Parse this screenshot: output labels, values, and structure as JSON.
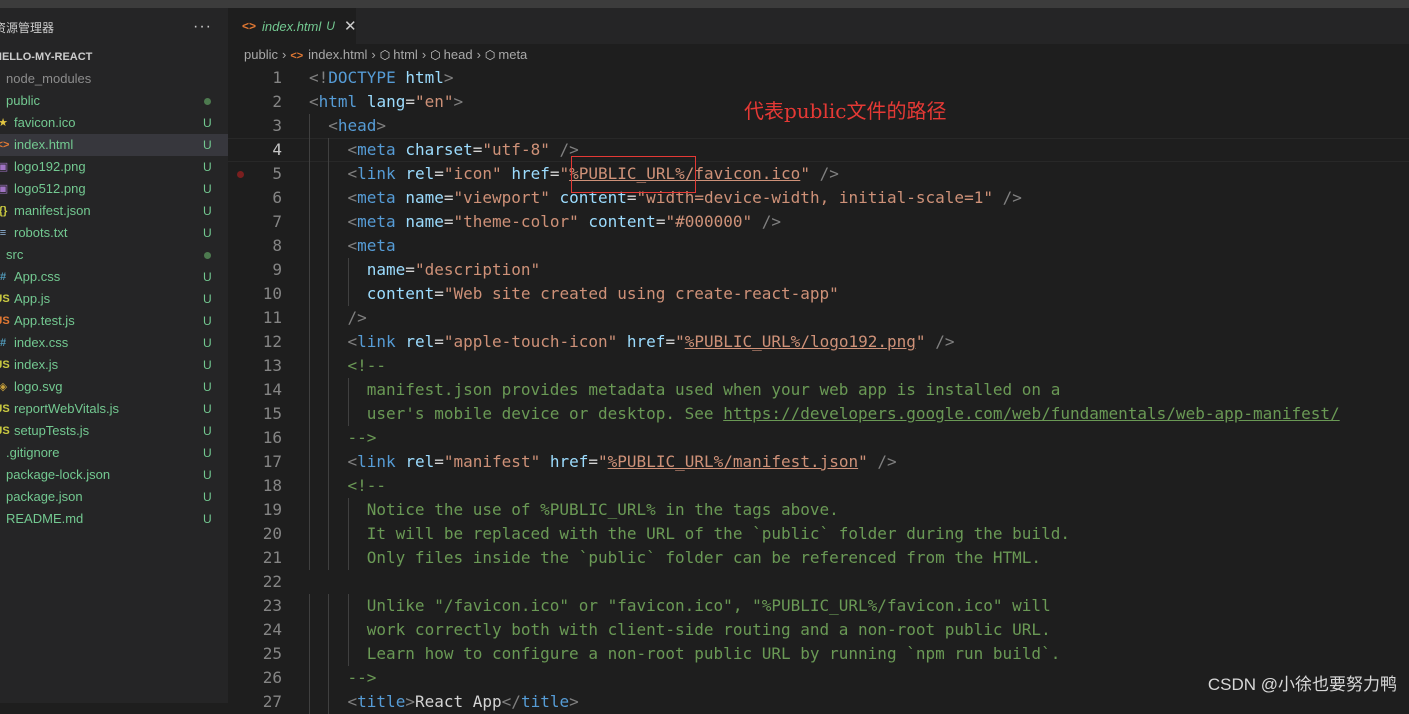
{
  "sidebar": {
    "title": "资源管理器",
    "more_label": "···",
    "section": "HELLO-MY-REACT",
    "items": [
      {
        "label": "node_modules",
        "kind": "folder",
        "icon": "",
        "status": "",
        "dot": false,
        "color": "#8c8c8c"
      },
      {
        "label": "public",
        "kind": "folder",
        "icon": "",
        "status": "",
        "dot": true,
        "color": "#73c991"
      },
      {
        "label": "favicon.ico",
        "kind": "file",
        "icon": "★",
        "iconColor": "#e2c541",
        "status": "U",
        "dot": false,
        "color": "#73c991"
      },
      {
        "label": "index.html",
        "kind": "file",
        "icon": "<>",
        "iconColor": "#e37933",
        "status": "U",
        "dot": false,
        "color": "#73c991",
        "selected": true
      },
      {
        "label": "logo192.png",
        "kind": "file",
        "icon": "▣",
        "iconColor": "#a074c4",
        "status": "U",
        "dot": false,
        "color": "#73c991"
      },
      {
        "label": "logo512.png",
        "kind": "file",
        "icon": "▣",
        "iconColor": "#a074c4",
        "status": "U",
        "dot": false,
        "color": "#73c991"
      },
      {
        "label": "manifest.json",
        "kind": "file",
        "icon": "{}",
        "iconColor": "#cbcb41",
        "status": "U",
        "dot": false,
        "color": "#73c991"
      },
      {
        "label": "robots.txt",
        "kind": "file",
        "icon": "≡",
        "iconColor": "#8fb4d8",
        "status": "U",
        "dot": false,
        "color": "#73c991"
      },
      {
        "label": "src",
        "kind": "folder",
        "icon": "",
        "status": "",
        "dot": true,
        "color": "#73c991"
      },
      {
        "label": "App.css",
        "kind": "file",
        "icon": "#",
        "iconColor": "#519aba",
        "status": "U",
        "dot": false,
        "color": "#73c991"
      },
      {
        "label": "App.js",
        "kind": "file",
        "icon": "JS",
        "iconColor": "#cbcb41",
        "status": "U",
        "dot": false,
        "color": "#73c991"
      },
      {
        "label": "App.test.js",
        "kind": "file",
        "icon": "JS",
        "iconColor": "#e37933",
        "status": "U",
        "dot": false,
        "color": "#73c991"
      },
      {
        "label": "index.css",
        "kind": "file",
        "icon": "#",
        "iconColor": "#519aba",
        "status": "U",
        "dot": false,
        "color": "#73c991"
      },
      {
        "label": "index.js",
        "kind": "file",
        "icon": "JS",
        "iconColor": "#cbcb41",
        "status": "U",
        "dot": false,
        "color": "#73c991"
      },
      {
        "label": "logo.svg",
        "kind": "file",
        "icon": "◈",
        "iconColor": "#c7a03a",
        "status": "U",
        "dot": false,
        "color": "#73c991"
      },
      {
        "label": "reportWebVitals.js",
        "kind": "file",
        "icon": "JS",
        "iconColor": "#cbcb41",
        "status": "U",
        "dot": false,
        "color": "#73c991"
      },
      {
        "label": "setupTests.js",
        "kind": "file",
        "icon": "JS",
        "iconColor": "#cbcb41",
        "status": "U",
        "dot": false,
        "color": "#73c991"
      },
      {
        "label": ".gitignore",
        "kind": "nofile",
        "icon": "",
        "status": "U",
        "dot": false,
        "color": "#73c991"
      },
      {
        "label": "package-lock.json",
        "kind": "nofile",
        "icon": "",
        "status": "U",
        "dot": false,
        "color": "#73c991"
      },
      {
        "label": "package.json",
        "kind": "nofile",
        "icon": "",
        "status": "U",
        "dot": false,
        "color": "#73c991"
      },
      {
        "label": "README.md",
        "kind": "nofile",
        "icon": "",
        "status": "U",
        "dot": false,
        "color": "#73c991"
      }
    ]
  },
  "tab": {
    "icon": "<>",
    "name": "index.html",
    "flag": "U",
    "close": "✕"
  },
  "breadcrumb": [
    {
      "label": "public",
      "icon": ""
    },
    {
      "label": "index.html",
      "icon": "<>"
    },
    {
      "label": "html",
      "icon": "⬡"
    },
    {
      "label": "head",
      "icon": "⬡"
    },
    {
      "label": "meta",
      "icon": "⬡"
    }
  ],
  "code": {
    "current_line": 4,
    "breakpoint_line": 5,
    "lines": [
      {
        "n": "1",
        "indent": 0,
        "tokens": [
          [
            "punc",
            "<!"
          ],
          [
            "tag",
            "DOCTYPE"
          ],
          [
            "txt",
            " "
          ],
          [
            "attr",
            "html"
          ],
          [
            "punc",
            ">"
          ]
        ]
      },
      {
        "n": "2",
        "indent": 0,
        "tokens": [
          [
            "punc",
            "<"
          ],
          [
            "tag",
            "html"
          ],
          [
            "txt",
            " "
          ],
          [
            "attr",
            "lang"
          ],
          [
            "txt",
            "="
          ],
          [
            "str",
            "\"en\""
          ],
          [
            "punc",
            ">"
          ]
        ]
      },
      {
        "n": "3",
        "indent": 1,
        "tokens": [
          [
            "punc",
            "<"
          ],
          [
            "tag",
            "head"
          ],
          [
            "punc",
            ">"
          ]
        ]
      },
      {
        "n": "4",
        "indent": 2,
        "tokens": [
          [
            "punc",
            "<"
          ],
          [
            "tag",
            "meta"
          ],
          [
            "txt",
            " "
          ],
          [
            "attr",
            "charset"
          ],
          [
            "txt",
            "="
          ],
          [
            "str",
            "\"utf-8\""
          ],
          [
            "txt",
            " "
          ],
          [
            "punc",
            "/>"
          ]
        ]
      },
      {
        "n": "5",
        "indent": 2,
        "tokens": [
          [
            "punc",
            "<"
          ],
          [
            "tag",
            "link"
          ],
          [
            "txt",
            " "
          ],
          [
            "attr",
            "rel"
          ],
          [
            "txt",
            "="
          ],
          [
            "str",
            "\"icon\""
          ],
          [
            "txt",
            " "
          ],
          [
            "attr",
            "href"
          ],
          [
            "txt",
            "="
          ],
          [
            "str",
            "\""
          ],
          [
            "sul",
            "%PUBLIC_URL%/favicon.ico"
          ],
          [
            "str",
            "\""
          ],
          [
            "txt",
            " "
          ],
          [
            "punc",
            "/>"
          ]
        ]
      },
      {
        "n": "6",
        "indent": 2,
        "tokens": [
          [
            "punc",
            "<"
          ],
          [
            "tag",
            "meta"
          ],
          [
            "txt",
            " "
          ],
          [
            "attr",
            "name"
          ],
          [
            "txt",
            "="
          ],
          [
            "str",
            "\"viewport\""
          ],
          [
            "txt",
            " "
          ],
          [
            "attr",
            "content"
          ],
          [
            "txt",
            "="
          ],
          [
            "str",
            "\"width=device-width, initial-scale=1\""
          ],
          [
            "txt",
            " "
          ],
          [
            "punc",
            "/>"
          ]
        ]
      },
      {
        "n": "7",
        "indent": 2,
        "tokens": [
          [
            "punc",
            "<"
          ],
          [
            "tag",
            "meta"
          ],
          [
            "txt",
            " "
          ],
          [
            "attr",
            "name"
          ],
          [
            "txt",
            "="
          ],
          [
            "str",
            "\"theme-color\""
          ],
          [
            "txt",
            " "
          ],
          [
            "attr",
            "content"
          ],
          [
            "txt",
            "="
          ],
          [
            "str",
            "\"#000000\""
          ],
          [
            "txt",
            " "
          ],
          [
            "punc",
            "/>"
          ]
        ]
      },
      {
        "n": "8",
        "indent": 2,
        "tokens": [
          [
            "punc",
            "<"
          ],
          [
            "tag",
            "meta"
          ]
        ]
      },
      {
        "n": "9",
        "indent": 3,
        "tokens": [
          [
            "attr",
            "name"
          ],
          [
            "txt",
            "="
          ],
          [
            "str",
            "\"description\""
          ]
        ]
      },
      {
        "n": "10",
        "indent": 3,
        "tokens": [
          [
            "attr",
            "content"
          ],
          [
            "txt",
            "="
          ],
          [
            "str",
            "\"Web site created using create-react-app\""
          ]
        ]
      },
      {
        "n": "11",
        "indent": 2,
        "tokens": [
          [
            "punc",
            "/>"
          ]
        ]
      },
      {
        "n": "12",
        "indent": 2,
        "tokens": [
          [
            "punc",
            "<"
          ],
          [
            "tag",
            "link"
          ],
          [
            "txt",
            " "
          ],
          [
            "attr",
            "rel"
          ],
          [
            "txt",
            "="
          ],
          [
            "str",
            "\"apple-touch-icon\""
          ],
          [
            "txt",
            " "
          ],
          [
            "attr",
            "href"
          ],
          [
            "txt",
            "="
          ],
          [
            "str",
            "\""
          ],
          [
            "sul",
            "%PUBLIC_URL%/logo192.png"
          ],
          [
            "str",
            "\""
          ],
          [
            "txt",
            " "
          ],
          [
            "punc",
            "/>"
          ]
        ]
      },
      {
        "n": "13",
        "indent": 2,
        "tokens": [
          [
            "com",
            "<!--"
          ]
        ]
      },
      {
        "n": "14",
        "indent": 3,
        "tokens": [
          [
            "com",
            "manifest.json provides metadata used when your web app is installed on a"
          ]
        ]
      },
      {
        "n": "15",
        "indent": 3,
        "tokens": [
          [
            "com",
            "user's mobile device or desktop. See "
          ],
          [
            "link",
            "https://developers.google.com/web/fundamentals/web-app-manifest/"
          ]
        ]
      },
      {
        "n": "16",
        "indent": 2,
        "tokens": [
          [
            "com",
            "-->"
          ]
        ]
      },
      {
        "n": "17",
        "indent": 2,
        "tokens": [
          [
            "punc",
            "<"
          ],
          [
            "tag",
            "link"
          ],
          [
            "txt",
            " "
          ],
          [
            "attr",
            "rel"
          ],
          [
            "txt",
            "="
          ],
          [
            "str",
            "\"manifest\""
          ],
          [
            "txt",
            " "
          ],
          [
            "attr",
            "href"
          ],
          [
            "txt",
            "="
          ],
          [
            "str",
            "\""
          ],
          [
            "sul",
            "%PUBLIC_URL%/manifest.json"
          ],
          [
            "str",
            "\""
          ],
          [
            "txt",
            " "
          ],
          [
            "punc",
            "/>"
          ]
        ]
      },
      {
        "n": "18",
        "indent": 2,
        "tokens": [
          [
            "com",
            "<!--"
          ]
        ]
      },
      {
        "n": "19",
        "indent": 3,
        "tokens": [
          [
            "com",
            "Notice the use of %PUBLIC_URL% in the tags above."
          ]
        ]
      },
      {
        "n": "20",
        "indent": 3,
        "tokens": [
          [
            "com",
            "It will be replaced with the URL of the `public` folder during the build."
          ]
        ]
      },
      {
        "n": "21",
        "indent": 3,
        "tokens": [
          [
            "com",
            "Only files inside the `public` folder can be referenced from the HTML."
          ]
        ]
      },
      {
        "n": "22",
        "indent": 0,
        "tokens": []
      },
      {
        "n": "23",
        "indent": 3,
        "tokens": [
          [
            "com",
            "Unlike \"/favicon.ico\" or \"favicon.ico\", \"%PUBLIC_URL%/favicon.ico\" will"
          ]
        ]
      },
      {
        "n": "24",
        "indent": 3,
        "tokens": [
          [
            "com",
            "work correctly both with client-side routing and a non-root public URL."
          ]
        ]
      },
      {
        "n": "25",
        "indent": 3,
        "tokens": [
          [
            "com",
            "Learn how to configure a non-root public URL by running `npm run build`."
          ]
        ]
      },
      {
        "n": "26",
        "indent": 2,
        "tokens": [
          [
            "com",
            "-->"
          ]
        ]
      },
      {
        "n": "27",
        "indent": 2,
        "tokens": [
          [
            "punc",
            "<"
          ],
          [
            "tag",
            "title"
          ],
          [
            "punc",
            ">"
          ],
          [
            "txt",
            "React App"
          ],
          [
            "punc",
            "</"
          ],
          [
            "tag",
            "title"
          ],
          [
            "punc",
            ">"
          ]
        ]
      }
    ]
  },
  "annotation": "代表public文件的路径",
  "watermark": "CSDN @小徐也要努力鸭"
}
